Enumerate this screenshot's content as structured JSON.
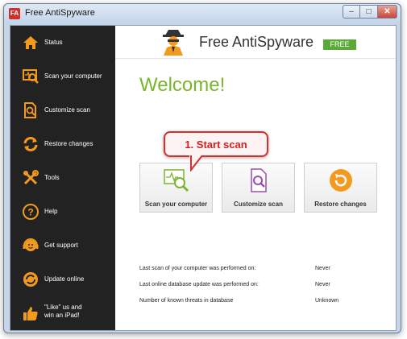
{
  "window": {
    "icon_text": "FA",
    "title": "Free AntiSpyware",
    "controls": {
      "minimize": "–",
      "maximize": "□",
      "close": "✕"
    }
  },
  "sidebar": {
    "items": [
      {
        "label": "Status",
        "icon": "home-icon"
      },
      {
        "label": "Scan your computer",
        "icon": "scan-computer-icon"
      },
      {
        "label": "Customize scan",
        "icon": "customize-scan-icon"
      },
      {
        "label": "Restore changes",
        "icon": "restore-icon"
      },
      {
        "label": "Tools",
        "icon": "tools-icon"
      },
      {
        "label": "Help",
        "icon": "help-icon"
      },
      {
        "label": "Get support",
        "icon": "support-icon"
      },
      {
        "label": "Update online",
        "icon": "update-icon"
      },
      {
        "label": "\"Like\" us and\nwin an iPad!",
        "icon": "like-icon"
      }
    ]
  },
  "header": {
    "app_name": "Free AntiSpyware",
    "badge": "FREE",
    "logo_icon": "spy-agent-icon"
  },
  "main": {
    "welcome": "Welcome!",
    "callout": "1. Start scan",
    "tiles": [
      {
        "label": "Scan your computer",
        "icon": "scan-computer-icon"
      },
      {
        "label": "Customize scan",
        "icon": "customize-scan-icon"
      },
      {
        "label": "Restore changes",
        "icon": "restore-icon"
      }
    ],
    "info": [
      {
        "label": "Last scan of your computer was performed on:",
        "value": "Never"
      },
      {
        "label": "Last online database update was performed on:",
        "value": "Never"
      },
      {
        "label": "Number of known threats in database",
        "value": "Unknown"
      }
    ]
  },
  "colors": {
    "accent": "#f39a1e",
    "sidebar_bg": "#222222",
    "welcome_green": "#7ab530",
    "badge_green": "#5aaa38",
    "callout_red": "#d82d2d"
  }
}
